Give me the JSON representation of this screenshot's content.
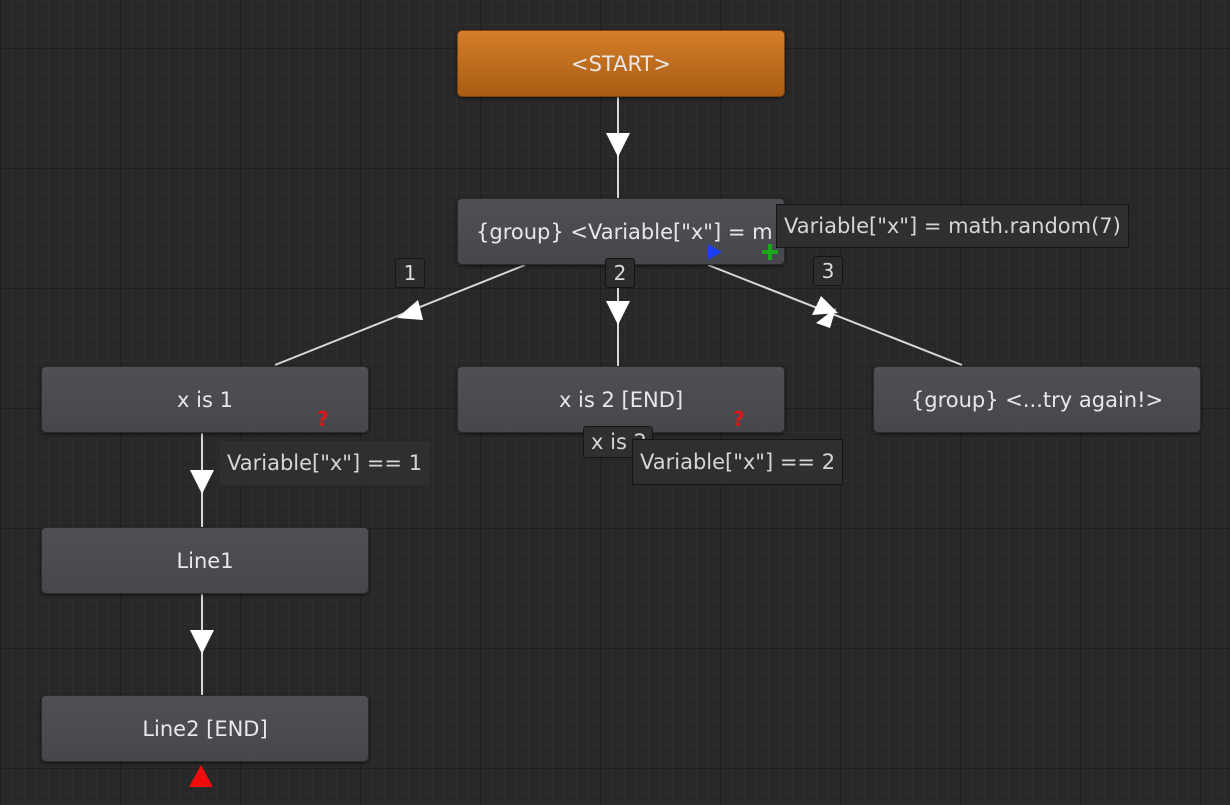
{
  "nodes": {
    "start": "<START>",
    "group_random": "{group} <Variable[\"x\"] = m",
    "x_is_1": "x is 1",
    "x_is_2_end": "x is 2 [END]",
    "group_try_again": "{group} <...try again!>",
    "line1": "Line1",
    "line2_end": "Line2 [END]"
  },
  "tooltips": {
    "random_assign": "Variable[\"x\"] = math.random(7)",
    "condition_x1": "Variable[\"x\"] == 1",
    "condition_x2": "Variable[\"x\"] == 2",
    "partial_node_label": "x is 2"
  },
  "branch_labels": [
    "1",
    "2",
    "3"
  ],
  "icons": {
    "condition_marker": "?",
    "play_marker": "play-icon",
    "add_marker": "plus-icon",
    "end_marker": "triangle-up-icon"
  },
  "colors": {
    "canvas": "#282828",
    "node": "#4b4d52",
    "start_node": "#c06d1d",
    "edge": "#d8d8d8",
    "question": "#e01515",
    "play": "#1d3cf0",
    "add": "#1aa81a"
  }
}
